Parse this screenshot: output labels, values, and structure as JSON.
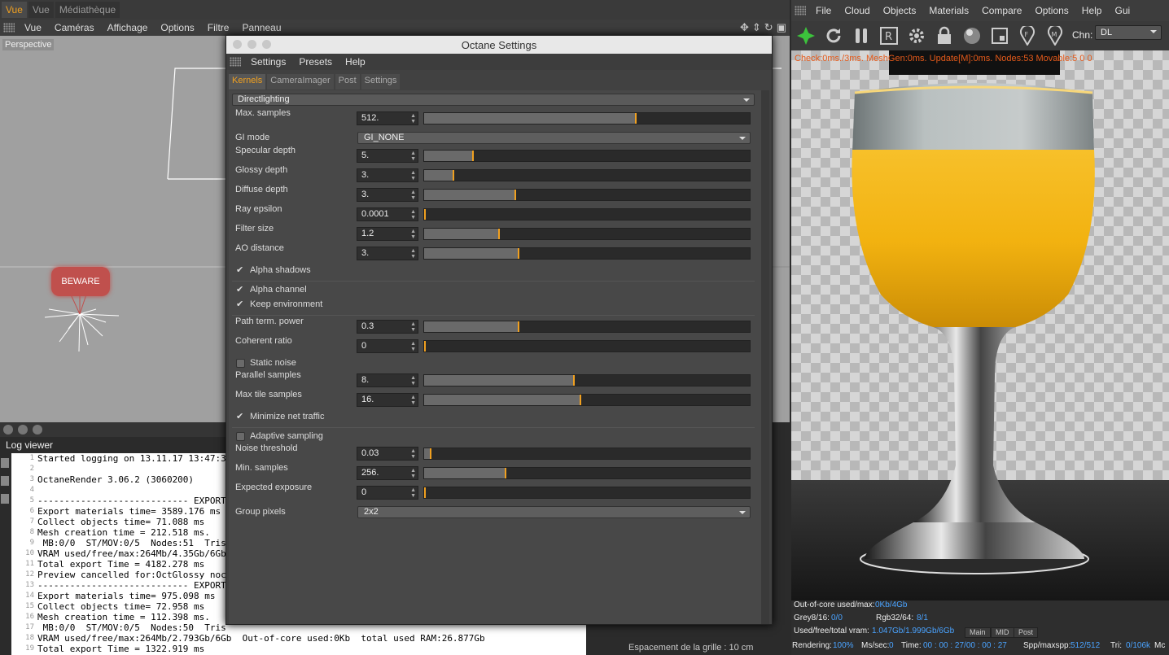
{
  "top_tabs": [
    "Vue",
    "Vue",
    "Médiathèque"
  ],
  "viewport": {
    "menu": [
      "Vue",
      "Caméras",
      "Affichage",
      "Options",
      "Filtre",
      "Panneau"
    ],
    "label": "Perspective",
    "beware": "BEWARE",
    "grid_status": "Espacement de la grille : 10 cm"
  },
  "log": {
    "title": "Log viewer",
    "lines": [
      {
        "n": "1",
        "t": "Started logging on 13.11.17 13:47:3"
      },
      {
        "n": "2",
        "t": ""
      },
      {
        "n": "3",
        "t": "OctaneRender 3.06.2 (3060200)"
      },
      {
        "n": "4",
        "t": ""
      },
      {
        "n": "5",
        "t": "---------------------------- EXPORT"
      },
      {
        "n": "6",
        "t": "Export materials time= 3589.176 ms"
      },
      {
        "n": "7",
        "t": "Collect objects time= 71.088 ms"
      },
      {
        "n": "8",
        "t": "Mesh creation time = 212.518 ms."
      },
      {
        "n": "9",
        "t": " MB:0/0  ST/MOV:0/5  Nodes:51  Tris"
      },
      {
        "n": "10",
        "t": "VRAM used/free/max:264Mb/4.35Gb/6Gb"
      },
      {
        "n": "11",
        "t": "Total export Time = 4182.278 ms"
      },
      {
        "n": "12",
        "t": "Preview cancelled for:OctGlossy noc"
      },
      {
        "n": "13",
        "t": "---------------------------- EXPORT"
      },
      {
        "n": "14",
        "t": "Export materials time= 975.098 ms"
      },
      {
        "n": "15",
        "t": "Collect objects time= 72.958 ms"
      },
      {
        "n": "16",
        "t": "Mesh creation time = 112.398 ms."
      },
      {
        "n": "17",
        "t": " MB:0/0  ST/MOV:0/5  Nodes:50  Tris"
      },
      {
        "n": "18",
        "t": "VRAM used/free/max:264Mb/2.793Gb/6Gb  Out-of-core used:0Kb  total used RAM:26.877Gb"
      },
      {
        "n": "19",
        "t": "Total export Time = 1322.919 ms"
      }
    ]
  },
  "settings": {
    "title": "Octane Settings",
    "menu": [
      "Settings",
      "Presets",
      "Help"
    ],
    "tabs": [
      "Kernels",
      "CameraImager",
      "Post",
      "Settings"
    ],
    "kernel": "Directlighting",
    "max_samples": {
      "label": "Max. samples",
      "value": "512.",
      "fill": 0.65
    },
    "gi_mode": {
      "label": "GI mode",
      "value": "GI_NONE"
    },
    "specular_depth": {
      "label": "Specular depth",
      "value": "5.",
      "fill": 0.15
    },
    "glossy_depth": {
      "label": "Glossy depth",
      "value": "3.",
      "fill": 0.09
    },
    "diffuse_depth": {
      "label": "Diffuse depth",
      "value": "3.",
      "fill": 0.28
    },
    "ray_epsilon": {
      "label": "Ray epsilon",
      "value": "0.0001",
      "fill": 0.0
    },
    "filter_size": {
      "label": "Filter size",
      "value": "1.2",
      "fill": 0.23
    },
    "ao_distance": {
      "label": "AO distance",
      "value": "3.",
      "fill": 0.29
    },
    "alpha_shadows": {
      "label": "Alpha shadows",
      "checked": true
    },
    "alpha_channel": {
      "label": "Alpha channel",
      "checked": true
    },
    "keep_environment": {
      "label": "Keep environment",
      "checked": true
    },
    "path_term_power": {
      "label": "Path term. power",
      "value": "0.3",
      "fill": 0.29
    },
    "coherent_ratio": {
      "label": "Coherent ratio",
      "value": "0",
      "fill": 0.0
    },
    "static_noise": {
      "label": "Static noise",
      "checked": false
    },
    "parallel_samples": {
      "label": "Parallel samples",
      "value": "8.",
      "fill": 0.46
    },
    "max_tile_samples": {
      "label": "Max tile samples",
      "value": "16.",
      "fill": 0.48
    },
    "minimize_net_traffic": {
      "label": "Minimize net traffic",
      "checked": true
    },
    "adaptive_sampling": {
      "label": "Adaptive sampling",
      "checked": false
    },
    "noise_threshold": {
      "label": "Noise threshold",
      "value": "0.03",
      "fill": 0.02
    },
    "min_samples": {
      "label": "Min. samples",
      "value": "256.",
      "fill": 0.25
    },
    "expected_exposure": {
      "label": "Expected exposure",
      "value": "0",
      "fill": 0.0
    },
    "group_pixels": {
      "label": "Group pixels",
      "value": "2x2"
    }
  },
  "live": {
    "menu": [
      "File",
      "Cloud",
      "Objects",
      "Materials",
      "Compare",
      "Options",
      "Help",
      "Gui"
    ],
    "chn_label": "Chn:",
    "chn_value": "DL",
    "stats": "Check:0ms./3ms. MeshGen:0ms. Update[M]:0ms. Nodes:53 Movable:5  0 0",
    "out_of_core_label": "Out-of-core used/max:",
    "out_of_core_value": "0Kb/4Gb",
    "grey_label": "Grey8/16:",
    "grey_value": "0/0",
    "rgb_label": "Rgb32/64:",
    "rgb_value": "8/1",
    "vram_label": "Used/free/total vram:",
    "vram_value": "1.047Gb/1.999Gb/6Gb",
    "mini_tabs": [
      "Main",
      "MID",
      "Post"
    ],
    "rendering_label": "Rendering:",
    "rendering_value": "100%",
    "ms_label": "Ms/sec:",
    "ms_value": "0",
    "time_label": "Time:",
    "time_value": "00 : 00 : 27/00 : 00 : 27",
    "spp_label": "Spp/maxspp:",
    "spp_value": "512/512",
    "tri_label": "Tri:",
    "tri_value": "0/106k",
    "trailing": "Mc"
  },
  "colors": {
    "accent": "#f0a020",
    "stats": "#e55a1a",
    "value_blue": "#4aa3ff"
  }
}
